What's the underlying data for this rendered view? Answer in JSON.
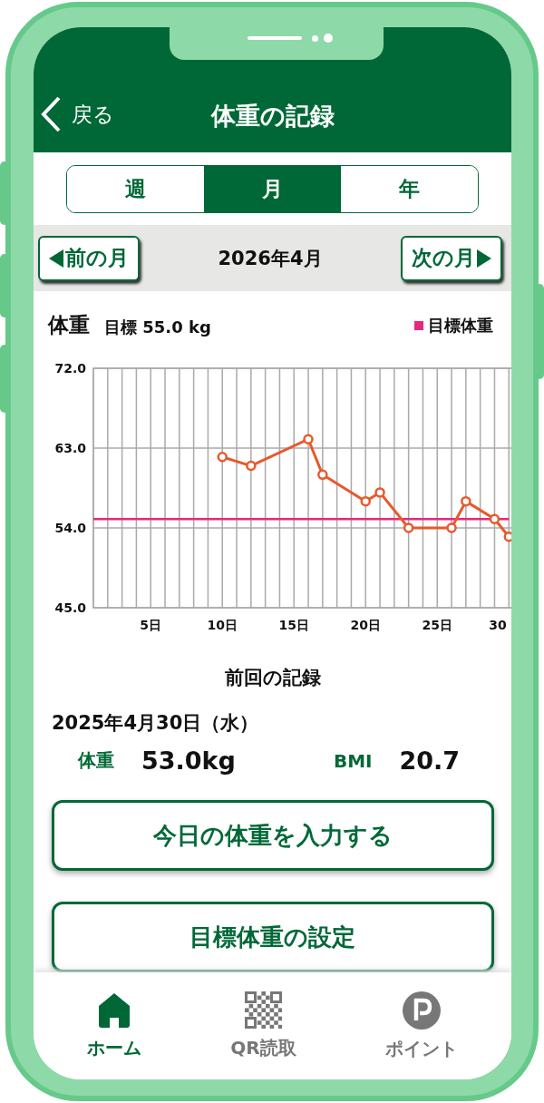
{
  "header": {
    "back_label": "戻る",
    "title": "体重の記録"
  },
  "period_tabs": [
    {
      "label": "週",
      "selected": false
    },
    {
      "label": "月",
      "selected": true
    },
    {
      "label": "年",
      "selected": false
    }
  ],
  "month_nav": {
    "prev_label": "前の月",
    "current": "2026年4月",
    "next_label": "次の月"
  },
  "chart_section": {
    "target": "目標 55.0 kg",
    "chart_data": {
      "type": "line",
      "x": [
        1,
        2,
        3,
        4,
        5,
        6,
        7,
        8,
        9,
        10,
        11,
        12,
        13,
        14,
        15,
        16,
        17,
        18,
        19,
        20,
        21,
        22,
        23,
        24,
        25,
        26,
        27,
        28,
        29,
        30
      ],
      "grid": true,
      "series": [
        {
          "name": "体重",
          "color": "#e8582c",
          "marker": true,
          "values": [
            null,
            null,
            null,
            null,
            null,
            null,
            null,
            null,
            null,
            62,
            null,
            61,
            null,
            null,
            null,
            64,
            60,
            null,
            null,
            57,
            58,
            null,
            54,
            null,
            null,
            54,
            57,
            null,
            55,
            53
          ]
        },
        {
          "name": "目標体重",
          "color": "#e6287f",
          "values": [
            55,
            55,
            55,
            55,
            55,
            55,
            55,
            55,
            55,
            55,
            55,
            55,
            55,
            55,
            55,
            55,
            55,
            55,
            55,
            55,
            55,
            55,
            55,
            55,
            55,
            55,
            55,
            55,
            55,
            55
          ]
        }
      ],
      "xlim": [
        1,
        30.3
      ],
      "ylim": [
        45,
        72
      ],
      "xticks": [
        {
          "value": 5,
          "label": "5日"
        },
        {
          "value": 10,
          "label": "10日"
        },
        {
          "value": 15,
          "label": "15日"
        },
        {
          "value": 20,
          "label": "20日"
        },
        {
          "value": 25,
          "label": "25日"
        },
        {
          "value": 30,
          "label": "30"
        }
      ],
      "yticks": [
        {
          "value": 45,
          "label": "45.0"
        },
        {
          "value": 54,
          "label": "54.0"
        },
        {
          "value": 63,
          "label": "63.0"
        },
        {
          "value": 72,
          "label": "72.0"
        }
      ]
    }
  },
  "last_record": {
    "heading": "前回の記録",
    "date": "2025年4月30日（水）",
    "weight_label": "体重",
    "weight_value": "53.0kg",
    "bmi_label": "BMI",
    "bmi_value": "20.7"
  },
  "actions": [
    "今日の体重を入力する",
    "目標体重の設定"
  ],
  "bottom_nav": [
    {
      "label": "ホーム",
      "kind": "home",
      "selected": true
    },
    {
      "label": "QR読取",
      "kind": "qr",
      "selected": false
    },
    {
      "label": "ポイント",
      "kind": "point",
      "selected": false
    }
  ]
}
